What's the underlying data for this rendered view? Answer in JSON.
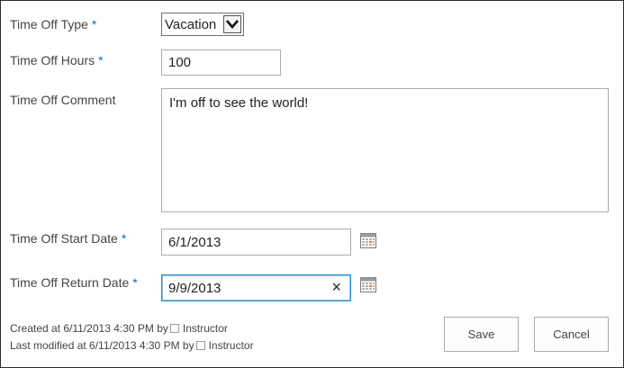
{
  "form": {
    "type": {
      "label": "Time Off Type",
      "required": "*",
      "value": "Vacation"
    },
    "hours": {
      "label": "Time Off Hours",
      "required": "*",
      "value": "100"
    },
    "comment": {
      "label": "Time Off Comment",
      "value": "I'm off to see the world!"
    },
    "start_date": {
      "label": "Time Off Start Date",
      "required": "*",
      "value": "6/1/2013"
    },
    "return_date": {
      "label": "Time Off Return Date",
      "required": "*",
      "value": "9/9/2013",
      "clear_icon": "×"
    }
  },
  "meta": {
    "created_prefix": "Created at 6/11/2013 4:30 PM  by",
    "created_user": "Instructor",
    "modified_prefix": "Last modified at 6/11/2013 4:30 PM  by",
    "modified_user": "Instructor"
  },
  "buttons": {
    "save": "Save",
    "cancel": "Cancel"
  },
  "colors": {
    "required": "#0072c6",
    "active_border": "#2a8dd4",
    "label": "#444444"
  }
}
